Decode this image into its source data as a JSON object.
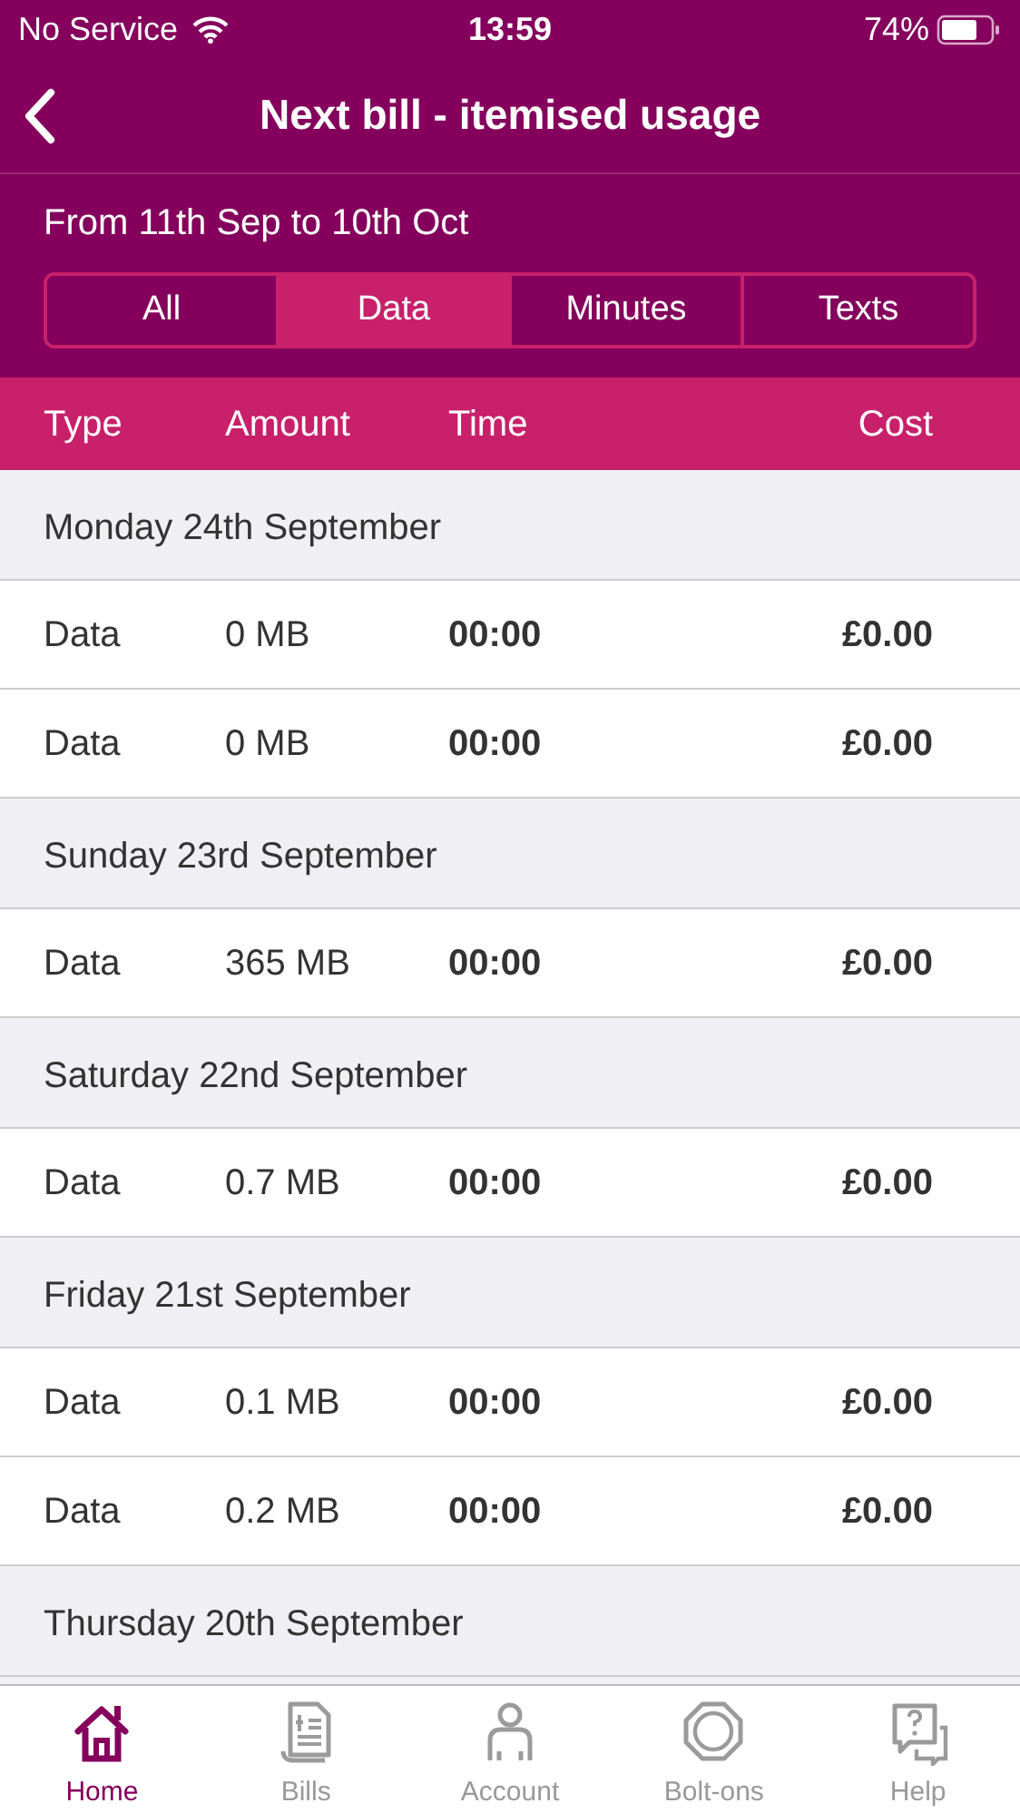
{
  "status_bar": {
    "carrier": "No Service",
    "time": "13:59",
    "battery": "74%"
  },
  "header": {
    "title": "Next bill - itemised usage"
  },
  "period": "From 11th Sep to 10th Oct",
  "filter_tabs": [
    {
      "label": "All",
      "selected": false
    },
    {
      "label": "Data",
      "selected": true
    },
    {
      "label": "Minutes",
      "selected": false
    },
    {
      "label": "Texts",
      "selected": false
    }
  ],
  "table": {
    "columns": [
      "Type",
      "Amount",
      "Time",
      "Cost"
    ],
    "groups": [
      {
        "date": "Monday 24th September",
        "rows": [
          {
            "type": "Data",
            "amount": "0 MB",
            "time": "00:00",
            "cost": "£0.00"
          },
          {
            "type": "Data",
            "amount": "0 MB",
            "time": "00:00",
            "cost": "£0.00"
          }
        ]
      },
      {
        "date": "Sunday 23rd September",
        "rows": [
          {
            "type": "Data",
            "amount": "365 MB",
            "time": "00:00",
            "cost": "£0.00"
          }
        ]
      },
      {
        "date": "Saturday 22nd September",
        "rows": [
          {
            "type": "Data",
            "amount": "0.7 MB",
            "time": "00:00",
            "cost": "£0.00"
          }
        ]
      },
      {
        "date": "Friday 21st September",
        "rows": [
          {
            "type": "Data",
            "amount": "0.1 MB",
            "time": "00:00",
            "cost": "£0.00"
          },
          {
            "type": "Data",
            "amount": "0.2 MB",
            "time": "00:00",
            "cost": "£0.00"
          }
        ]
      },
      {
        "date": "Thursday 20th September"
      }
    ]
  },
  "tab_bar": [
    {
      "label": "Home",
      "kind": "home",
      "selected": true
    },
    {
      "label": "Bills",
      "kind": "bills",
      "selected": false
    },
    {
      "label": "Account",
      "kind": "account",
      "selected": false
    },
    {
      "label": "Bolt-ons",
      "kind": "boltons",
      "selected": false
    },
    {
      "label": "Help",
      "kind": "help",
      "selected": false
    }
  ]
}
